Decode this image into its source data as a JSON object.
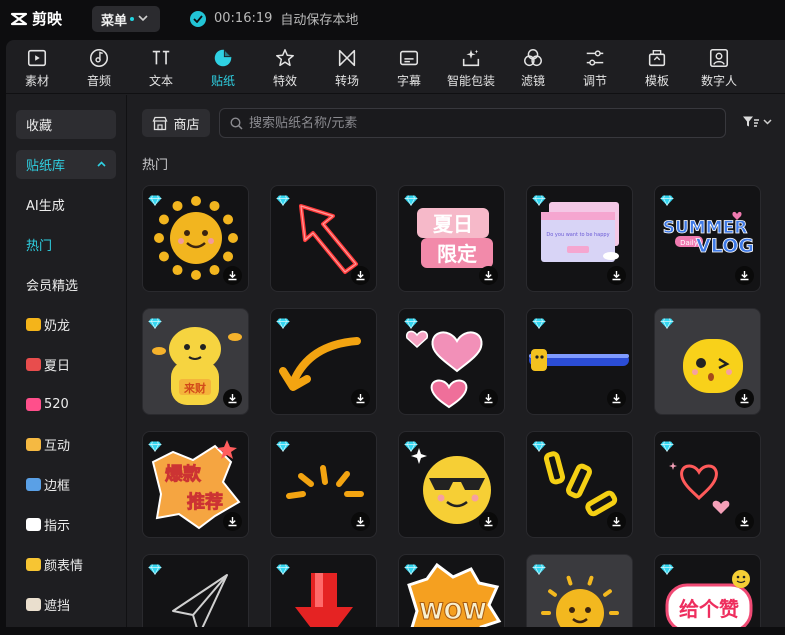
{
  "app": {
    "name": "剪映",
    "menu_label": "菜单",
    "save_time": "00:16:19",
    "save_text": "自动保存本地"
  },
  "toolbar": [
    {
      "label": "素材",
      "icon": "media-icon"
    },
    {
      "label": "音频",
      "icon": "audio-icon"
    },
    {
      "label": "文本",
      "icon": "text-icon"
    },
    {
      "label": "贴纸",
      "icon": "sticker-icon",
      "active": true
    },
    {
      "label": "特效",
      "icon": "effects-icon"
    },
    {
      "label": "转场",
      "icon": "transition-icon"
    },
    {
      "label": "字幕",
      "icon": "subtitle-icon"
    },
    {
      "label": "智能包装",
      "icon": "smart-pack-icon"
    },
    {
      "label": "滤镜",
      "icon": "filter-icon"
    },
    {
      "label": "调节",
      "icon": "adjust-icon"
    },
    {
      "label": "模板",
      "icon": "template-icon"
    },
    {
      "label": "数字人",
      "icon": "digital-human-icon"
    }
  ],
  "sidebar": {
    "items": [
      {
        "label": "收藏",
        "style": "box"
      },
      {
        "label": "贴纸库",
        "style": "box-cyan"
      },
      {
        "label": "AI生成"
      },
      {
        "label": "热门",
        "style": "cyan"
      },
      {
        "label": "会员精选"
      },
      {
        "label": "奶龙",
        "emoji_color": "#f4b41a"
      },
      {
        "label": "夏日",
        "emoji_color": "#e84d4d"
      },
      {
        "label": "520",
        "emoji_color": "#ff4f8b"
      },
      {
        "label": "互动",
        "emoji_color": "#f5b942"
      },
      {
        "label": "边框",
        "emoji_color": "#5aa0e6"
      },
      {
        "label": "指示",
        "emoji_color": "#ffffff"
      },
      {
        "label": "颜表情",
        "emoji_color": "#f7c533"
      },
      {
        "label": "遮挡",
        "emoji_color": "#eadfce"
      }
    ]
  },
  "content": {
    "store_label": "商店",
    "search_placeholder": "搜索贴纸名称/元素",
    "section_title": "热门",
    "stickers": [
      {
        "name": "sun-smile-sticker"
      },
      {
        "name": "neon-arrow-sticker"
      },
      {
        "name": "summer-limited-sticker",
        "text": "夏日限定"
      },
      {
        "name": "popup-windows-sticker",
        "text": "Do you want to be happy"
      },
      {
        "name": "summer-vlog-sticker",
        "text": "SUMMER Daily VLOG"
      },
      {
        "name": "naillong-money-sticker",
        "text": "来财"
      },
      {
        "name": "orange-arrow-sticker"
      },
      {
        "name": "pink-hearts-sticker"
      },
      {
        "name": "progress-bar-sticker"
      },
      {
        "name": "yellow-wink-sticker"
      },
      {
        "name": "hot-recommend-sticker",
        "text": "爆款推荐"
      },
      {
        "name": "burst-lines-sticker"
      },
      {
        "name": "cool-face-sticker"
      },
      {
        "name": "yellow-marks-sticker"
      },
      {
        "name": "red-heart-sticker"
      },
      {
        "name": "paper-plane-sticker"
      },
      {
        "name": "red-down-arrow-sticker"
      },
      {
        "name": "wow-bubble-sticker",
        "text": "WOW"
      },
      {
        "name": "sun-face-sticker"
      },
      {
        "name": "give-like-sticker",
        "text": "给个赞"
      }
    ]
  }
}
